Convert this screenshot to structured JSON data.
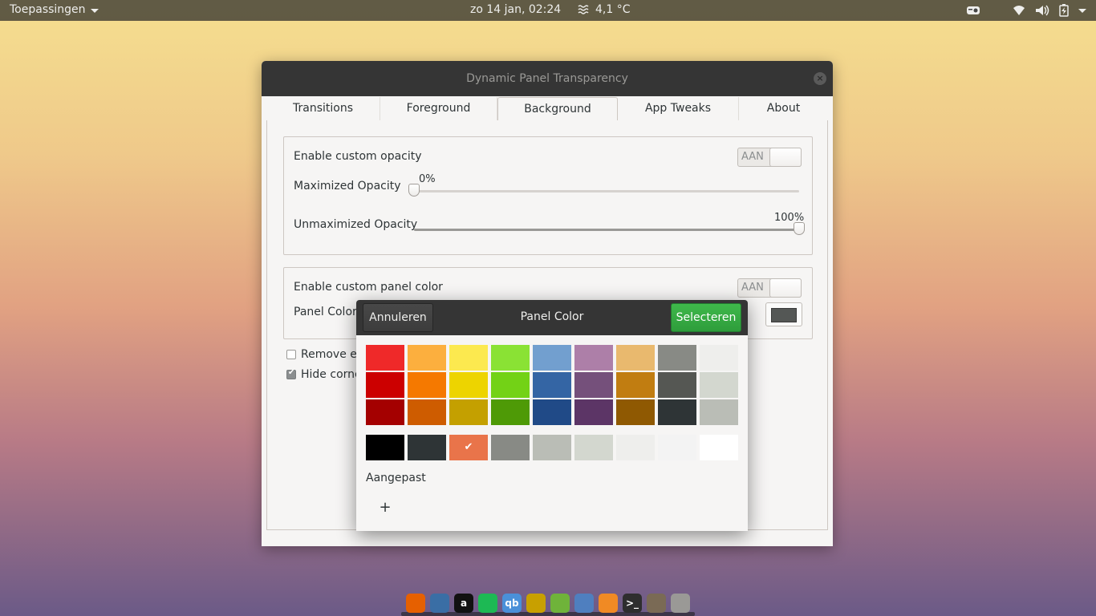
{
  "topbar": {
    "apps_label": "Toepassingen",
    "clock": "zo 14 jan, 02:24",
    "weather": "4,1 °C",
    "tray_icons": [
      "mixer-icon",
      "wifi-icon",
      "volume-icon",
      "battery-icon",
      "system-menu-caret-icon"
    ]
  },
  "window": {
    "title": "Dynamic Panel Transparency",
    "tabs": [
      "Transitions",
      "Foreground",
      "Background",
      "App Tweaks",
      "About"
    ],
    "active_tab": "Background",
    "opacity_section": {
      "enable_label": "Enable custom opacity",
      "enable_state": "AAN",
      "maximized_label": "Maximized Opacity",
      "maximized_value": "0%",
      "maximized_fraction": 0.0,
      "unmaximized_label": "Unmaximized Opacity",
      "unmaximized_value": "100%",
      "unmaximized_fraction": 1.0
    },
    "color_section": {
      "enable_label": "Enable custom panel color",
      "enable_state": "AAN",
      "panel_color_label": "Panel Color",
      "panel_color_value": "#545755"
    },
    "checks": [
      {
        "label": "Remove ex",
        "checked": false
      },
      {
        "label": "Hide corne",
        "checked": true
      }
    ]
  },
  "dialog": {
    "title": "Panel Color",
    "cancel_label": "Annuleren",
    "select_label": "Selecteren",
    "palette_rows": [
      [
        "#ef2929",
        "#fcaf3e",
        "#fce94f",
        "#8ae234",
        "#729fcf",
        "#ad7fa8",
        "#e9b96e",
        "#888a85",
        "#eeeeec"
      ],
      [
        "#cc0000",
        "#f57900",
        "#edd400",
        "#73d216",
        "#3465a4",
        "#75507b",
        "#c17d11",
        "#555753",
        "#d3d7cf"
      ],
      [
        "#a40000",
        "#ce5c00",
        "#c4a000",
        "#4e9a06",
        "#204a87",
        "#5c3566",
        "#8f5902",
        "#2e3436",
        "#babdb6"
      ]
    ],
    "gray_row": [
      "#000000",
      "#2e3436",
      "#e9744a",
      "#888a85",
      "#babdb6",
      "#d3d7cf",
      "#eeeeec",
      "#f3f3f3",
      "#ffffff"
    ],
    "selected_gray_index": 2,
    "custom_label": "Aangepast",
    "add_custom_symbol": "+"
  },
  "dock": {
    "apps": [
      {
        "name": "firefox-icon",
        "glyph": "",
        "color": "#e66000"
      },
      {
        "name": "thunderbird-icon",
        "glyph": "",
        "color": "#3a6ea5"
      },
      {
        "name": "amazon-icon",
        "glyph": "a",
        "color": "#111111"
      },
      {
        "name": "spotify-icon",
        "glyph": "",
        "color": "#1db954"
      },
      {
        "name": "qbittorrent-icon",
        "glyph": "qb",
        "color": "#4a90d9"
      },
      {
        "name": "network-icon",
        "glyph": "",
        "color": "#c8a000"
      },
      {
        "name": "rss-reader-icon",
        "glyph": "",
        "color": "#6fb33a"
      },
      {
        "name": "file-manager-icon",
        "glyph": "",
        "color": "#4f7fbf"
      },
      {
        "name": "settings-gear-icon",
        "glyph": "",
        "color": "#f08a24"
      },
      {
        "name": "terminal-icon",
        "glyph": ">_",
        "color": "#2e2e2e"
      },
      {
        "name": "gimp-icon",
        "glyph": "",
        "color": "#7a6a55"
      },
      {
        "name": "system-settings-icon",
        "glyph": "",
        "color": "#9a9996"
      }
    ]
  }
}
